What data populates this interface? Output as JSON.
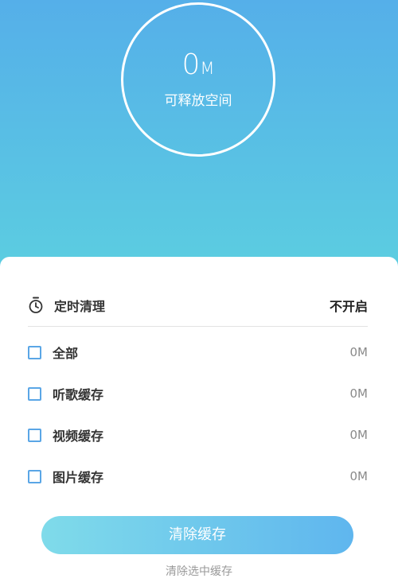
{
  "storage": {
    "value": "0",
    "unit": "M",
    "label": "可释放空间"
  },
  "timer": {
    "icon": "stopwatch-icon",
    "label": "定时清理",
    "value": "不开启"
  },
  "items": [
    {
      "label": "全部",
      "size": "0M",
      "checked": false
    },
    {
      "label": "听歌缓存",
      "size": "0M",
      "checked": false
    },
    {
      "label": "视频缓存",
      "size": "0M",
      "checked": false
    },
    {
      "label": "图片缓存",
      "size": "0M",
      "checked": false
    }
  ],
  "actions": {
    "clear_cache": "清除缓存",
    "clear_selected": "清除选中缓存"
  },
  "colors": {
    "header_top": "#55afe9",
    "header_bottom": "#5ccfe0",
    "checkbox_border": "#5aa6e6",
    "button_start": "#7fdbea",
    "button_end": "#5fb6ee"
  }
}
